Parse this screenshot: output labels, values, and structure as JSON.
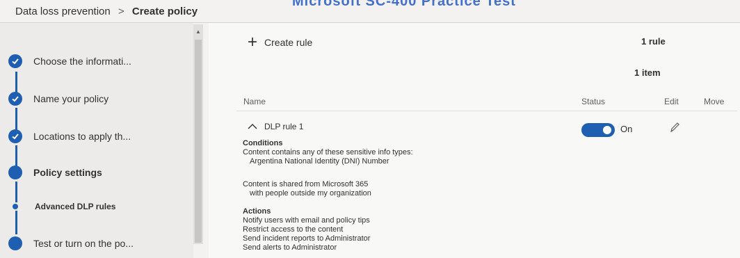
{
  "watermark": "Microsoft SC-400 Practice Test",
  "breadcrumb": {
    "parent": "Data loss prevention",
    "separator": ">",
    "current": "Create policy"
  },
  "wizard": {
    "steps": [
      {
        "label": "Choose the informati...",
        "state": "complete"
      },
      {
        "label": "Name your policy",
        "state": "complete"
      },
      {
        "label": "Locations to apply th...",
        "state": "complete"
      },
      {
        "label": "Policy settings",
        "state": "current"
      },
      {
        "label": "Advanced DLP rules",
        "state": "current-substep"
      },
      {
        "label": "Test or turn on the po...",
        "state": "pending"
      }
    ]
  },
  "toolbar": {
    "create_rule_label": "Create rule",
    "rule_count": "1 rule",
    "item_count": "1 item"
  },
  "table": {
    "columns": [
      "Name",
      "Status",
      "Edit",
      "Move"
    ],
    "rows": [
      {
        "name": "DLP rule 1",
        "status": "On",
        "conditions_heading": "Conditions",
        "condition_1": "Content contains any of these sensitive info types:",
        "condition_1_value": "Argentina National Identity (DNI) Number",
        "condition_2": "Content is shared from Microsoft 365",
        "condition_2_value": "with people outside my organization",
        "actions_heading": "Actions",
        "actions": [
          "Notify users with email and policy tips",
          "Restrict access to the content",
          "Send incident reports to Administrator",
          "Send alerts to Administrator"
        ]
      }
    ]
  },
  "colors": {
    "accent": "#1f5fb2",
    "background": "#f3f2f1"
  }
}
